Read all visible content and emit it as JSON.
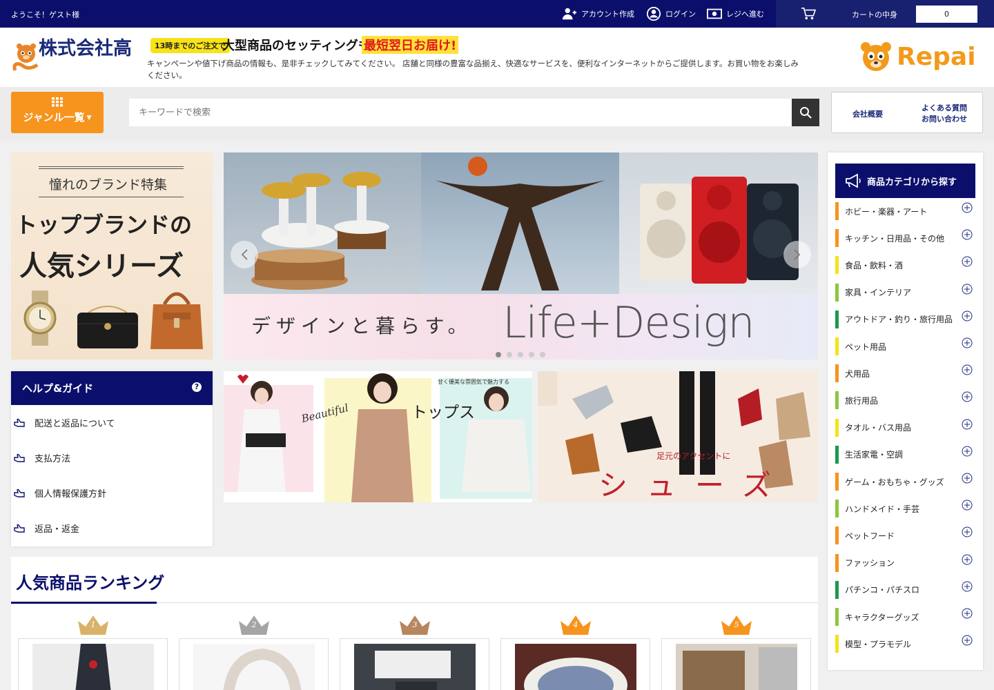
{
  "topbar": {
    "welcome": "ようこそ！ゲスト様",
    "account_create": "アカウント作成",
    "login": "ログイン",
    "checkout": "レジへ進む",
    "cart_label": "カートの中身",
    "cart_count": "0"
  },
  "header": {
    "company": "株式会社高",
    "promo_badge": "13時までのご注文で",
    "promo_main": "大型商品のセッティングも",
    "promo_red": "最短翌日お届け!",
    "description": "キャンペーンや値下げ商品の情報も、是非チェックしてみてください。 店舗と同様の豊富な品揃え、快適なサービスを、便利なインターネットからご提供します。お買い物をお楽しみください。",
    "brand_logo_text": "Repai"
  },
  "search": {
    "genre_label": "ジャンル一覧",
    "placeholder": "キーワードで検索",
    "about": "会社概要",
    "faq_line1": "よくある質問",
    "faq_line2": "お問い合わせ"
  },
  "brand_banner": {
    "sub": "憧れのブランド特集",
    "main1": "トップブランドの",
    "main2": "人気シリーズ"
  },
  "carousel": {
    "caption": "デザインと暮らす。",
    "headline": "Life+Design",
    "slide_count": 5,
    "active_slide": 1
  },
  "help": {
    "title": "ヘルプ&ガイド",
    "items": [
      "配送と返品について",
      "支払方法",
      "個人情報保護方針",
      "返品・返金"
    ]
  },
  "fashion_banner": {
    "beautiful": "Beautiful",
    "tops": "トップス",
    "tagline": "甘く優美な雰囲気で魅力する"
  },
  "shoes_banner": {
    "tagline": "足元のアクセントに",
    "title": "シューズ"
  },
  "ranking": {
    "title": "人気商品ランキング",
    "ranks": [
      "1",
      "2",
      "3",
      "4",
      "5"
    ],
    "crown_colors": [
      "#d9b26a",
      "#a5a5a5",
      "#b8855d",
      "#f7941d",
      "#f7941d"
    ]
  },
  "categories": {
    "title": "商品カテゴリから探す",
    "items": [
      {
        "label": "ホビー・楽器・アート",
        "color": "#f7941d"
      },
      {
        "label": "キッチン・日用品・その他",
        "color": "#f7941d"
      },
      {
        "label": "食品・飲料・酒",
        "color": "#f4e21a"
      },
      {
        "label": "家具・インテリア",
        "color": "#8cc63f"
      },
      {
        "label": "アウトドア・釣り・旅行用品",
        "color": "#1a9a4a"
      },
      {
        "label": "ペット用品",
        "color": "#f4e21a"
      },
      {
        "label": "犬用品",
        "color": "#f7941d"
      },
      {
        "label": "旅行用品",
        "color": "#8cc63f"
      },
      {
        "label": "タオル・バス用品",
        "color": "#f4e21a"
      },
      {
        "label": "生活家電・空調",
        "color": "#1a9a4a"
      },
      {
        "label": "ゲーム・おもちゃ・グッズ",
        "color": "#f7941d"
      },
      {
        "label": "ハンドメイド・手芸",
        "color": "#8cc63f"
      },
      {
        "label": "ペットフード",
        "color": "#f7941d"
      },
      {
        "label": "ファッション",
        "color": "#f7941d"
      },
      {
        "label": "パチンコ・パチスロ",
        "color": "#1a9a4a"
      },
      {
        "label": "キャラクターグッズ",
        "color": "#8cc63f"
      },
      {
        "label": "模型・プラモデル",
        "color": "#f4e21a"
      }
    ]
  }
}
